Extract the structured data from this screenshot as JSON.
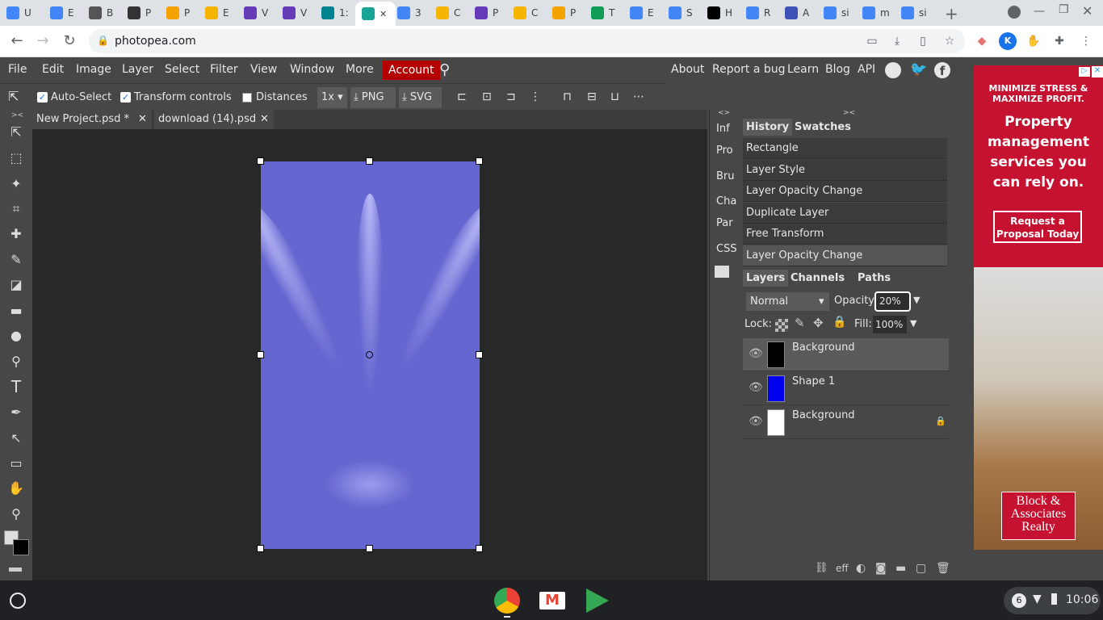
{
  "browser": {
    "tabs": [
      {
        "label": "U",
        "color": "#4285f4"
      },
      {
        "label": "E",
        "color": "#4285f4"
      },
      {
        "label": "B",
        "color": "#555"
      },
      {
        "label": "P",
        "color": "#333"
      },
      {
        "label": "P",
        "color": "#f4a300"
      },
      {
        "label": "E",
        "color": "#f4b400"
      },
      {
        "label": "V",
        "color": "#673ab7"
      },
      {
        "label": "V",
        "color": "#673ab7"
      },
      {
        "label": "1:",
        "color": "#00838f"
      },
      {
        "label": "3",
        "color": "#4285f4"
      },
      {
        "label": "C",
        "color": "#f4b400"
      },
      {
        "label": "P",
        "color": "#673ab7"
      },
      {
        "label": "C",
        "color": "#f4b400"
      },
      {
        "label": "P",
        "color": "#f4a300"
      },
      {
        "label": "T",
        "color": "#0f9d58"
      },
      {
        "label": "E",
        "color": "#4285f4"
      },
      {
        "label": "S",
        "color": "#4285f4"
      },
      {
        "label": "H",
        "color": "#000"
      },
      {
        "label": "R",
        "color": "#4285f4"
      },
      {
        "label": "A",
        "color": "#3f51b5"
      },
      {
        "label": "si",
        "color": "#4285f4"
      },
      {
        "label": "m",
        "color": "#4285f4"
      },
      {
        "label": "si",
        "color": "#4285f4"
      }
    ],
    "url": "photopea.com"
  },
  "menubar": {
    "items": [
      "File",
      "Edit",
      "Image",
      "Layer",
      "Select",
      "Filter",
      "View",
      "Window",
      "More"
    ],
    "account": "Account",
    "right_links": [
      "About",
      "Report a bug",
      "Learn",
      "Blog",
      "API"
    ]
  },
  "toolopts": {
    "auto_select": "Auto-Select",
    "transform_controls": "Transform controls",
    "distances": "Distances",
    "zoom": "1x",
    "png": "PNG",
    "svg": "SVG"
  },
  "doc_tabs": [
    {
      "label": "New Project.psd *"
    },
    {
      "label": "download (14).psd"
    }
  ],
  "side_labels": [
    "Inf",
    "Pro",
    "Bru",
    "Cha",
    "Par",
    "CSS"
  ],
  "history": {
    "tabs": [
      "History",
      "Swatches"
    ],
    "items": [
      "Rectangle",
      "Layer Style",
      "Layer Opacity Change",
      "Duplicate Layer",
      "Free Transform",
      "Layer Opacity Change"
    ]
  },
  "layers": {
    "tabs": [
      "Layers",
      "Channels",
      "Paths"
    ],
    "blend": "Normal",
    "opacity_label": "Opacity:",
    "opacity": "20%",
    "lock_label": "Lock:",
    "fill_label": "Fill:",
    "fill": "100%",
    "items": [
      {
        "name": "Background",
        "thumb": "#000"
      },
      {
        "name": "Shape 1",
        "thumb": "#0000ee"
      },
      {
        "name": "Background",
        "thumb": "#fff"
      }
    ]
  },
  "panel_footer": {
    "eff": "eff"
  },
  "ad": {
    "headline": "MINIMIZE STRESS & MAXIMIZE PROFIT.",
    "body": "Property management services you can rely on.",
    "cta": "Request a Proposal Today",
    "brand": "Block & Associates Realty"
  },
  "shelf": {
    "time": "10:06",
    "badge": "6"
  }
}
